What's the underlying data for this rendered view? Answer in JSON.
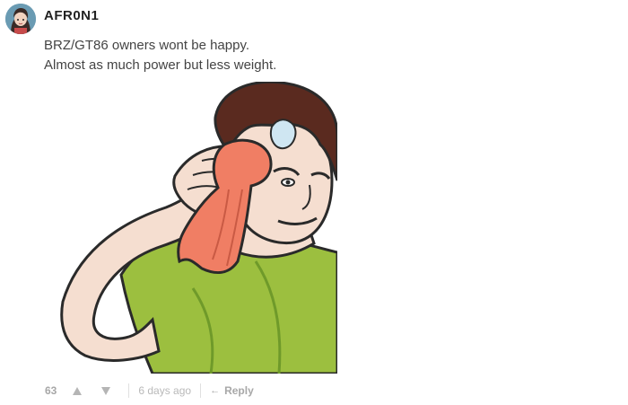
{
  "comment": {
    "username": "AFR0N1",
    "lines": [
      "BRZ/GT86 owners wont be happy.",
      "Almost as much power but less weight."
    ]
  },
  "actions": {
    "score": "63",
    "upvote_icon": "upvote-triangle-icon",
    "downvote_icon": "downvote-triangle-icon",
    "time": "6 days ago",
    "reply_icon": "reply-arrow-icon",
    "reply_label": "Reply"
  },
  "colors": {
    "meta_gray": "#b9b9b9",
    "text": "#444444"
  }
}
